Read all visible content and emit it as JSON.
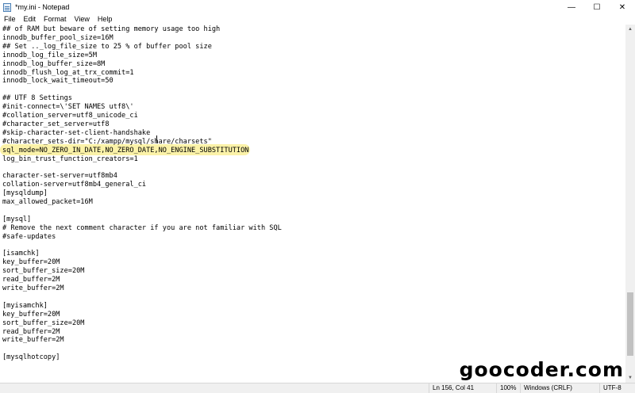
{
  "window": {
    "title": "*my.ini - Notepad",
    "controls": [
      "—",
      "☐",
      "✕"
    ]
  },
  "menu": [
    "File",
    "Edit",
    "Format",
    "View",
    "Help"
  ],
  "editor": {
    "highlight_color": "#fbf2a8",
    "lines": [
      "## of RAM but beware of setting memory usage too high",
      "innodb_buffer_pool_size=16M",
      "## Set .._log_file_size to 25 % of buffer pool size",
      "innodb_log_file_size=5M",
      "innodb_log_buffer_size=8M",
      "innodb_flush_log_at_trx_commit=1",
      "innodb_lock_wait_timeout=50",
      "",
      "## UTF 8 Settings",
      "#init-connect=\\'SET NAMES utf8\\'",
      "#collation_server=utf8_unicode_ci",
      "#character_set_server=utf8",
      "#skip-character-set-client-handshake",
      "#character_sets-dir=\"C:/xampp/mysql/share/charsets\"",
      "sql_mode=NO_ZERO_IN_DATE,NO_ZERO_DATE,NO_ENGINE_SUBSTITUTION",
      "log_bin_trust_function_creators=1",
      "",
      "character-set-server=utf8mb4",
      "collation-server=utf8mb4_general_ci",
      "[mysqldump]",
      "max_allowed_packet=16M",
      "",
      "[mysql]",
      "# Remove the next comment character if you are not familiar with SQL",
      "#safe-updates",
      "",
      "[isamchk]",
      "key_buffer=20M",
      "sort_buffer_size=20M",
      "read_buffer=2M",
      "write_buffer=2M",
      "",
      "[myisamchk]",
      "key_buffer=20M",
      "sort_buffer_size=20M",
      "read_buffer=2M",
      "write_buffer=2M",
      "",
      "[mysqlhotcopy]"
    ]
  },
  "status": {
    "position": "Ln 156, Col 41",
    "zoom": "100%",
    "line_ending": "Windows (CRLF)",
    "encoding": "UTF-8"
  },
  "watermark": "goocoder.com"
}
